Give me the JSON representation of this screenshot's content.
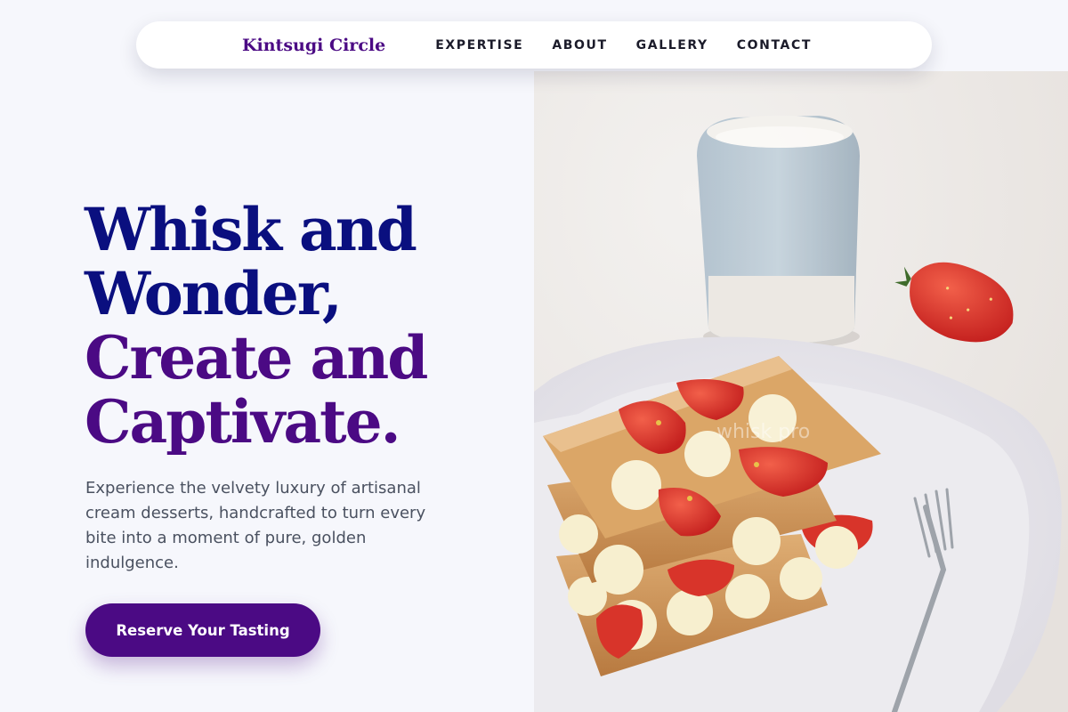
{
  "nav": {
    "brand": "Kintsugi Circle",
    "links": [
      "EXPERTISE",
      "ABOUT",
      "GALLERY",
      "CONTACT"
    ]
  },
  "hero": {
    "headline_line1": "Whisk and Wonder,",
    "headline_line2": "Create and Captivate.",
    "subtext": "Experience the velvety luxury of artisanal cream desserts, handcrafted to turn every bite into a moment of pure, golden indulgence.",
    "cta_label": "Reserve Your Tasting",
    "image_alt": "Strawberry mille-feuille with cream on a white plate beside a milk jug and fork",
    "watermark": "whisk pro"
  },
  "colors": {
    "navy": "#0a0f7f",
    "purple": "#4b0a84",
    "background": "#f6f7fc",
    "text_muted": "#4a5160"
  }
}
